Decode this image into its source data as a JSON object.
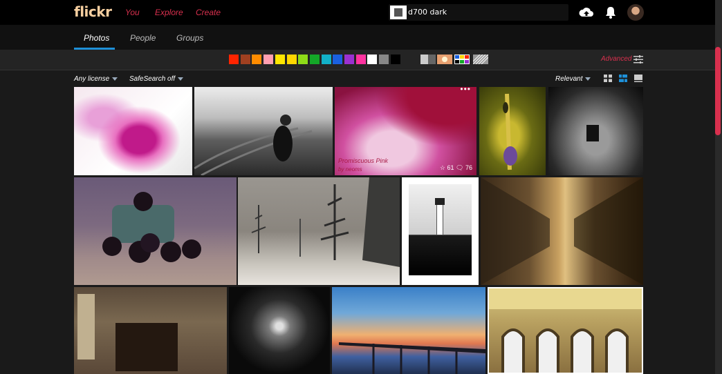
{
  "header": {
    "logo": "flickr",
    "nav": [
      "You",
      "Explore",
      "Create"
    ],
    "search_value": "d700 dark",
    "icons": [
      "upload-icon",
      "notifications-icon",
      "avatar"
    ]
  },
  "tabs": [
    "Photos",
    "People",
    "Groups"
  ],
  "active_tab": "Photos",
  "color_filters": [
    "#ff2400",
    "#a04020",
    "#ff8c00",
    "#ff9fb0",
    "#ffe600",
    "#ffd700",
    "#8fdc18",
    "#14a828",
    "#12b0c8",
    "#1a60e0",
    "#9b30d0",
    "#ff33a0",
    "#ffffff",
    "#888888",
    "#000000"
  ],
  "advanced_label": "Advanced",
  "filters": {
    "license": "Any license",
    "safesearch": "SafeSearch off",
    "sort": "Relevant"
  },
  "featured_photo": {
    "title": "Promiscuous Pink",
    "by": "by neoms",
    "faves": "61",
    "comments": "76",
    "more": "•••"
  }
}
